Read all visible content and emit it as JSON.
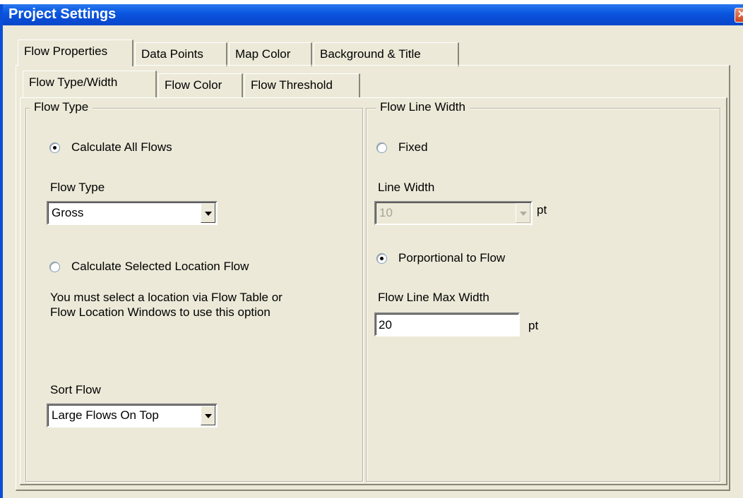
{
  "window": {
    "title": "Project Settings",
    "close_glyph": "✕"
  },
  "main_tabs": [
    {
      "label": "Flow Properties",
      "active": true
    },
    {
      "label": "Data Points",
      "active": false
    },
    {
      "label": "Map Color",
      "active": false
    },
    {
      "label": "Background & Title",
      "active": false
    }
  ],
  "sub_tabs": [
    {
      "label": "Flow Type/Width",
      "active": true
    },
    {
      "label": "Flow Color",
      "active": false
    },
    {
      "label": "Flow Threshold",
      "active": false
    }
  ],
  "flow_type_group": {
    "legend": "Flow Type",
    "calc_all_label": "Calculate All Flows",
    "calc_all_checked": true,
    "flow_type_label": "Flow Type",
    "flow_type_value": "Gross",
    "calc_selected_label": "Calculate Selected Location Flow",
    "calc_selected_checked": false,
    "note": "You must select a location via Flow Table or Flow Location Windows to use this option",
    "sort_label": "Sort Flow",
    "sort_value": "Large Flows On Top"
  },
  "line_width_group": {
    "legend": "Flow Line Width",
    "fixed_label": "Fixed",
    "fixed_checked": false,
    "line_width_label": "Line Width",
    "line_width_value": "10",
    "line_width_unit": "pt",
    "proportional_label": "Porportional to Flow",
    "proportional_checked": true,
    "max_width_label": "Flow Line Max Width",
    "max_width_value": "20",
    "max_width_unit": "pt"
  },
  "colors": {
    "title_bar": "#0a4fd8",
    "dialog_bg": "#ece9d8",
    "close_button": "#d3411d"
  }
}
